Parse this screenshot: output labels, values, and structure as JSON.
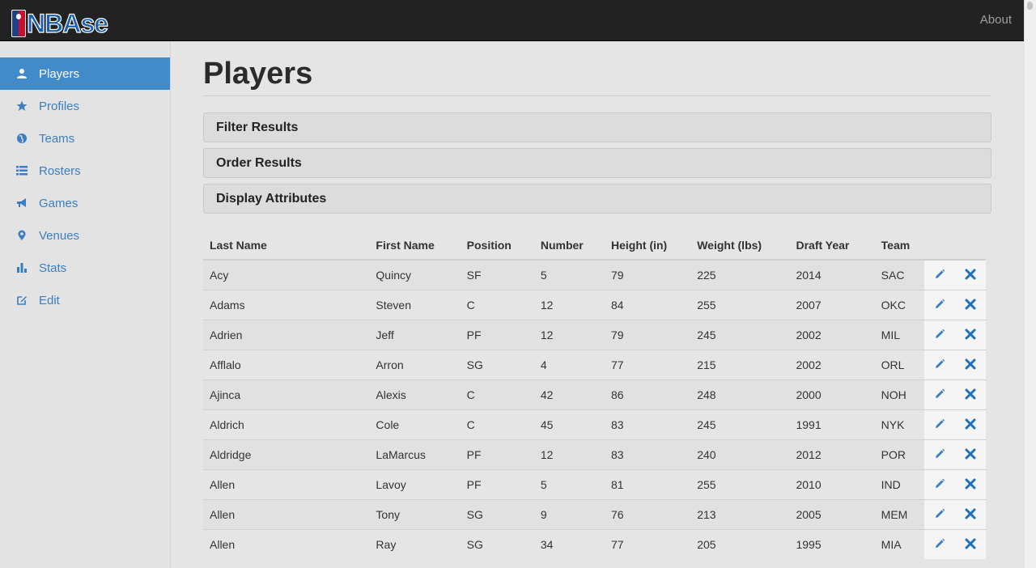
{
  "header": {
    "logo_text": "NBAse",
    "about_label": "About"
  },
  "sidebar": {
    "items": [
      {
        "label": "Players",
        "icon": "user-icon",
        "active": true
      },
      {
        "label": "Profiles",
        "icon": "star-icon",
        "active": false
      },
      {
        "label": "Teams",
        "icon": "globe-icon",
        "active": false
      },
      {
        "label": "Rosters",
        "icon": "list-icon",
        "active": false
      },
      {
        "label": "Games",
        "icon": "bullhorn-icon",
        "active": false
      },
      {
        "label": "Venues",
        "icon": "map-marker-icon",
        "active": false
      },
      {
        "label": "Stats",
        "icon": "stats-icon",
        "active": false
      },
      {
        "label": "Edit",
        "icon": "edit-icon",
        "active": false
      }
    ]
  },
  "main": {
    "title": "Players",
    "panels": {
      "filter": "Filter Results",
      "order": "Order Results",
      "display": "Display Attributes"
    },
    "table": {
      "headers": [
        "Last Name",
        "First Name",
        "Position",
        "Number",
        "Height (in)",
        "Weight (lbs)",
        "Draft Year",
        "Team"
      ],
      "rows": [
        [
          "Acy",
          "Quincy",
          "SF",
          "5",
          "79",
          "225",
          "2014",
          "SAC"
        ],
        [
          "Adams",
          "Steven",
          "C",
          "12",
          "84",
          "255",
          "2007",
          "OKC"
        ],
        [
          "Adrien",
          "Jeff",
          "PF",
          "12",
          "79",
          "245",
          "2002",
          "MIL"
        ],
        [
          "Afflalo",
          "Arron",
          "SG",
          "4",
          "77",
          "215",
          "2002",
          "ORL"
        ],
        [
          "Ajinca",
          "Alexis",
          "C",
          "42",
          "86",
          "248",
          "2000",
          "NOH"
        ],
        [
          "Aldrich",
          "Cole",
          "C",
          "45",
          "83",
          "245",
          "1991",
          "NYK"
        ],
        [
          "Aldridge",
          "LaMarcus",
          "PF",
          "12",
          "83",
          "240",
          "2012",
          "POR"
        ],
        [
          "Allen",
          "Lavoy",
          "PF",
          "5",
          "81",
          "255",
          "2010",
          "IND"
        ],
        [
          "Allen",
          "Tony",
          "SG",
          "9",
          "76",
          "213",
          "2005",
          "MEM"
        ],
        [
          "Allen",
          "Ray",
          "SG",
          "34",
          "77",
          "205",
          "1995",
          "MIA"
        ]
      ]
    }
  },
  "colors": {
    "accent": "#428bca",
    "link": "#3a7fc1",
    "delete": "#1f6fbf",
    "topbar": "#222222"
  }
}
